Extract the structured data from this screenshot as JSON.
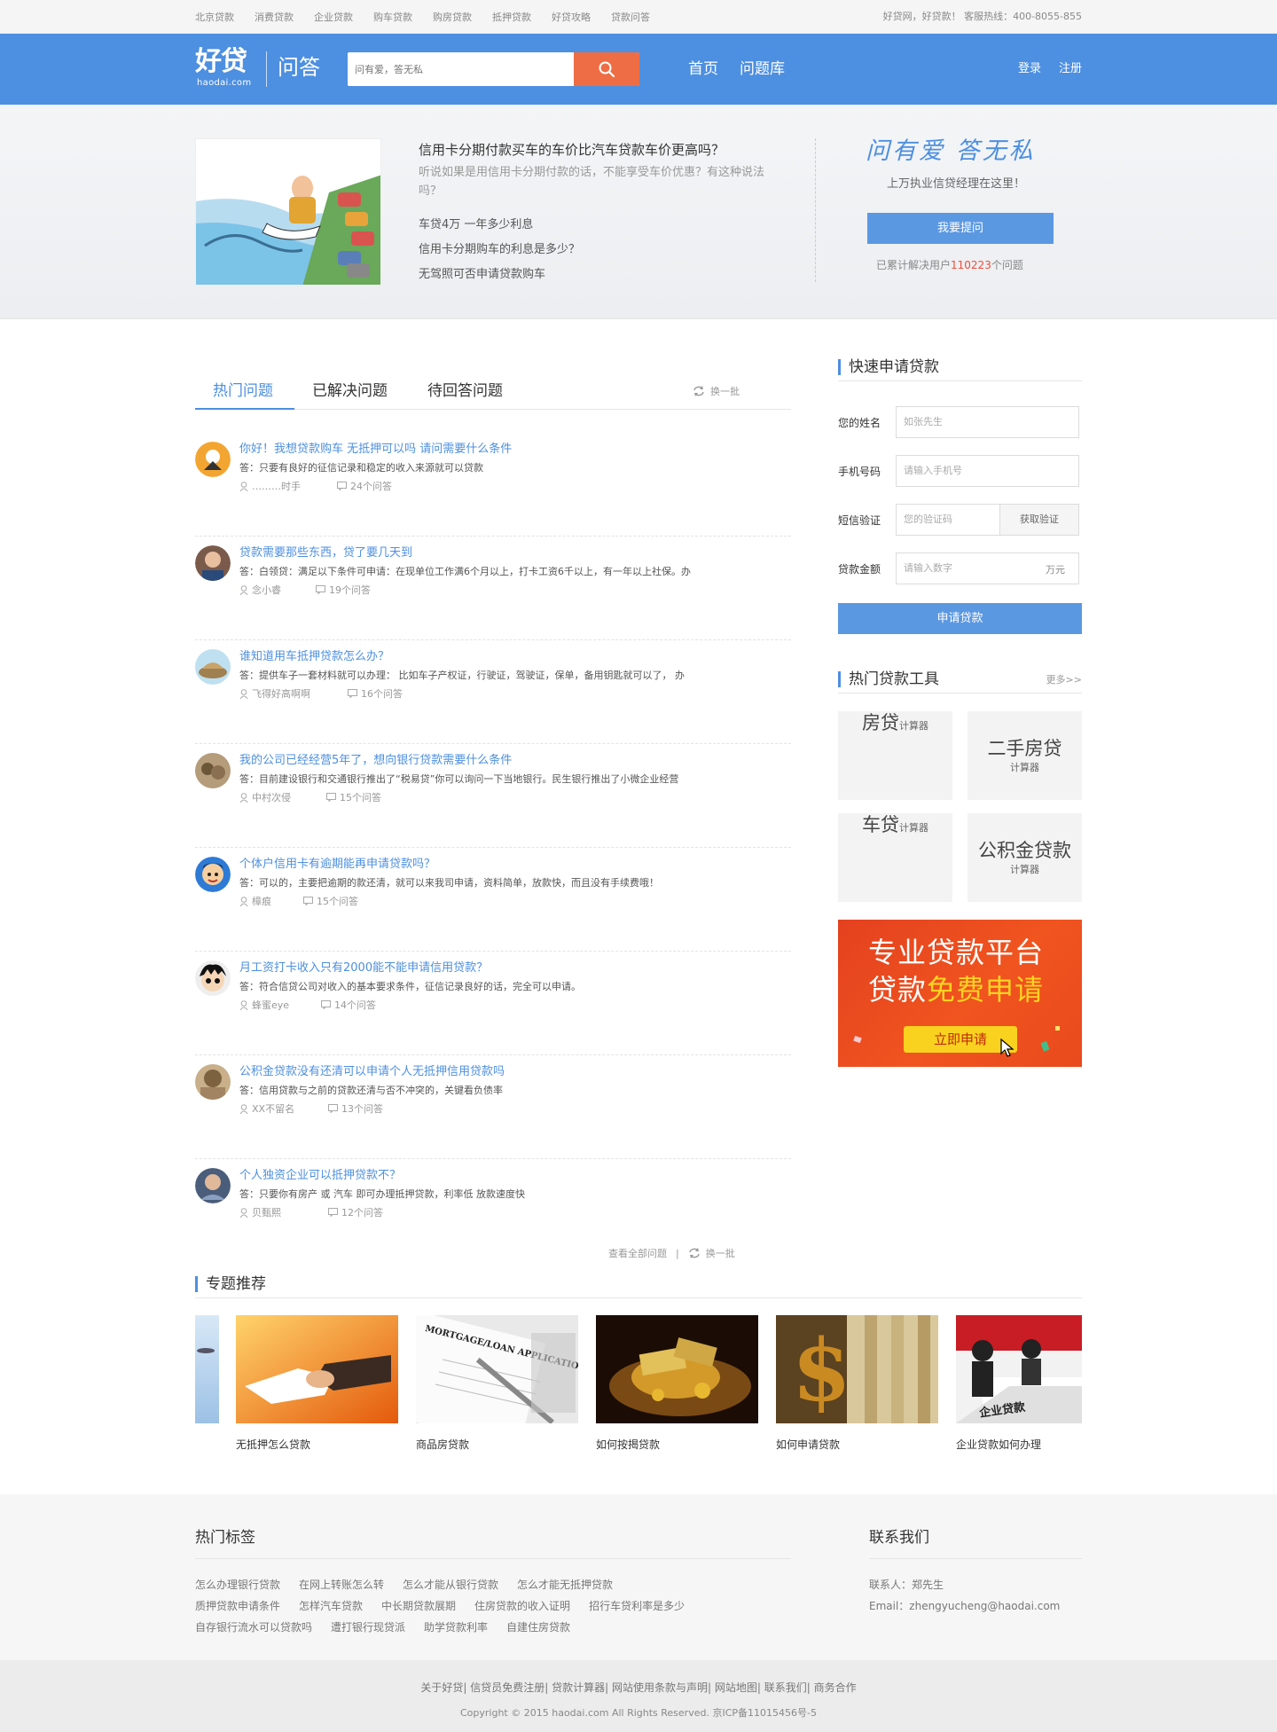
{
  "topbar": {
    "links": [
      "北京贷款",
      "消费贷款",
      "企业贷款",
      "购车贷款",
      "购房贷款",
      "抵押贷款",
      "好贷攻略",
      "贷款问答"
    ],
    "hotline": "好贷网，好贷款！ 客服热线：400-8055-855"
  },
  "header": {
    "logo_text": "好贷",
    "logo_domain": "haodai.com",
    "section": "问答",
    "search_placeholder": "问有爱，答无私",
    "nav": [
      "首页",
      "问题库"
    ],
    "login": "登录",
    "register": "注册"
  },
  "banner": {
    "question": "信用卡分期付款买车的车价比汽车贷款车价更高吗？",
    "description": "听说如果是用信用卡分期付款的话，不能享受车价优惠？有这种说法吗？",
    "related": [
      "车贷4万 一年多少利息",
      "信用卡分期购车的利息是多少？",
      "无驾照可否申请贷款购车"
    ],
    "slogan": "问有爱  答无私",
    "subtitle": "上万执业信贷经理在这里！",
    "ask_button": "我要提问",
    "solved_prefix": "已累计解决用户",
    "solved_count": "110223",
    "solved_suffix": "个问题"
  },
  "tabs": [
    "热门问题",
    "已解决问题",
    "待回答问题"
  ],
  "refresh_label": "换一批",
  "questions": [
    {
      "title": "你好！我想贷款购车 无抵押可以吗 请问需要什么条件",
      "answer": "答：只要有良好的征信记录和稳定的收入来源就可以贷款",
      "user": "………时手",
      "count": "24个问答"
    },
    {
      "title": "贷款需要那些东西，贷了要几天到",
      "answer": "答：白领贷：满足以下条件可申请：在现单位工作满6个月以上，打卡工资6千以上，有一年以上社保。办",
      "user": "念小睿",
      "count": "19个问答"
    },
    {
      "title": "谁知道用车抵押贷款怎么办？",
      "answer": "答：提供车子一套材料就可以办理： 比如车子产权证，行驶证，驾驶证，保单，备用钥匙就可以了， 办",
      "user": "飞得好高啊啊",
      "count": "16个问答"
    },
    {
      "title": "我的公司已经经营5年了，想向银行贷款需要什么条件",
      "answer": "答：目前建设银行和交通银行推出了“税易贷”你可以询问一下当地银行。民生银行推出了小微企业经营",
      "user": "中村次侵",
      "count": "15个问答"
    },
    {
      "title": "个体户信用卡有逾期能再申请贷款吗？",
      "answer": "答：可以的，主要把逾期的款还清，就可以来我司申请，资料简单，放款快，而且没有手续费哦！",
      "user": "樟痕",
      "count": "15个问答"
    },
    {
      "title": "月工资打卡收入只有2000能不能申请信用贷款？",
      "answer": "答：符合信贷公司对收入的基本要求条件，征信记录良好的话，完全可以申请。",
      "user": "蜂蜜eye",
      "count": "14个问答"
    },
    {
      "title": "公积金贷款没有还清可以申请个人无抵押信用贷款吗",
      "answer": "答：信用贷款与之前的贷款还清与否不冲突的，关键看负债率",
      "user": "XX不留名",
      "count": "13个问答"
    },
    {
      "title": "个人独资企业可以抵押贷款不？",
      "answer": "答：只要你有房产 或 汽车 即可办理抵押贷款，利率低 放款速度快",
      "user": "贝甄熙",
      "count": "12个问答"
    }
  ],
  "list_footer": {
    "view_all": "查看全部问题",
    "sep": "|",
    "refresh": "换一批"
  },
  "quick_apply": {
    "title": "快速申请贷款",
    "name_label": "您的姓名",
    "name_placeholder": "如张先生",
    "phone_label": "手机号码",
    "phone_placeholder": "请输入手机号",
    "sms_label": "短信验证",
    "sms_placeholder": "您的验证码",
    "sms_button": "获取验证",
    "amount_label": "贷款金额",
    "amount_placeholder": "请输入数字",
    "amount_unit": "万元",
    "submit": "申请贷款"
  },
  "tools": {
    "title": "热门贷款工具",
    "more": "更多>>",
    "items": [
      {
        "name": "房贷",
        "sub": "计算器"
      },
      {
        "name": "二手房贷",
        "sub": "计算器"
      },
      {
        "name": "车贷",
        "sub": "计算器"
      },
      {
        "name": "公积金贷款",
        "sub": "计算器"
      }
    ]
  },
  "ad": {
    "line1": "专业贷款平台",
    "line2_a": "贷款",
    "line2_b": "免费申请",
    "cta": "立即申请"
  },
  "topics": {
    "title": "专题推荐",
    "items": [
      "无抵押怎么贷款",
      "商品房贷款",
      "如何按揭贷款",
      "如何申请贷款",
      "企业贷款如何办理"
    ],
    "mortgage_text": "MORTGAGE/LOAN APPLICATION FORM",
    "sign_text": "企业贷款"
  },
  "footer": {
    "tags_title": "热门标签",
    "tags": [
      [
        "怎么办理银行贷款",
        "在网上转账怎么转",
        "怎么才能从银行贷款",
        "怎么才能无抵押贷款"
      ],
      [
        "质押贷款申请条件",
        "怎样汽车贷款",
        "中长期贷款展期",
        "住房贷款的收入证明",
        "招行车贷利率是多少"
      ],
      [
        "自存银行流水可以贷款吗",
        "遭打银行现贷派",
        "助学贷款利率",
        "自建住房贷款"
      ]
    ],
    "contact_title": "联系我们",
    "contact_person": "联系人：郑先生",
    "contact_email": "Email：zhengyucheng@haodai.com",
    "links": "关于好贷| 信贷员免费注册| 贷款计算器| 网站使用条款与声明| 网站地图| 联系我们| 商务合作",
    "copyright": "Copyright © 2015 haodai.com All Rights Reserved. 京ICP备11015456号-5"
  },
  "colors": {
    "brand": "#4d8fe0",
    "search_button": "#ee6d44",
    "highlight": "#ef4c3a",
    "ad_bg": "#e94a1d",
    "ad_cta": "#f8d21f"
  }
}
